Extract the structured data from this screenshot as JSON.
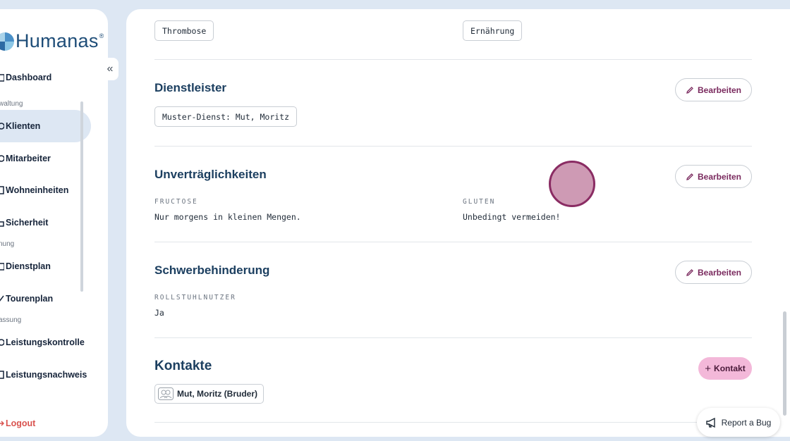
{
  "sidebar": {
    "logo_text": "Humanas",
    "logo_reg": "®",
    "items": [
      {
        "label": "Dashboard",
        "icon": "home-icon"
      },
      {
        "label": "Klienten",
        "icon": "users-icon",
        "active": true
      },
      {
        "label": "Mitarbeiter",
        "icon": "team-icon"
      },
      {
        "label": "Wohneinheiten",
        "icon": "building-icon"
      },
      {
        "label": "Sicherheit",
        "icon": "lock-icon"
      },
      {
        "label": "Dienstplan",
        "icon": "calendar-icon"
      },
      {
        "label": "Tourenplan",
        "icon": "route-icon"
      },
      {
        "label": "Leistungskontrolle",
        "icon": "check-icon"
      },
      {
        "label": "Leistungsnachweis",
        "icon": "document-icon"
      }
    ],
    "sections": [
      "waltung",
      "nung",
      "assung"
    ],
    "logout": "Logout",
    "collapse_glyph": "«"
  },
  "main": {
    "top_chips": [
      "Thrombose",
      "Ernährung"
    ],
    "dienstleister": {
      "title": "Dienstleister",
      "edit_label": "Bearbeiten",
      "chips": [
        "Muster-Dienst: Mut, Moritz"
      ]
    },
    "unvertraeglichkeiten": {
      "title": "Unverträglichkeiten",
      "edit_label": "Bearbeiten",
      "fields": [
        {
          "label": "FRUCTOSE",
          "value": "Nur morgens in kleinen Mengen."
        },
        {
          "label": "GLUTEN",
          "value": "Unbedingt vermeiden!"
        }
      ]
    },
    "schwerbehinderung": {
      "title": "Schwerbehinderung",
      "edit_label": "Bearbeiten",
      "fields": [
        {
          "label": "ROLLSTUHLNUTZER",
          "value": "Ja"
        }
      ]
    },
    "kontakte": {
      "title": "Kontakte",
      "add_label": "Kontakt",
      "add_glyph": "+",
      "contacts": [
        "Mut, Moritz (Bruder)"
      ]
    }
  },
  "report_bug": "Report a Bug",
  "colors": {
    "accent": "#7a2a5e",
    "title": "#1c3f60",
    "add_button": "#f3b8d9",
    "background": "#dde7f3",
    "logout": "#d9534f"
  }
}
